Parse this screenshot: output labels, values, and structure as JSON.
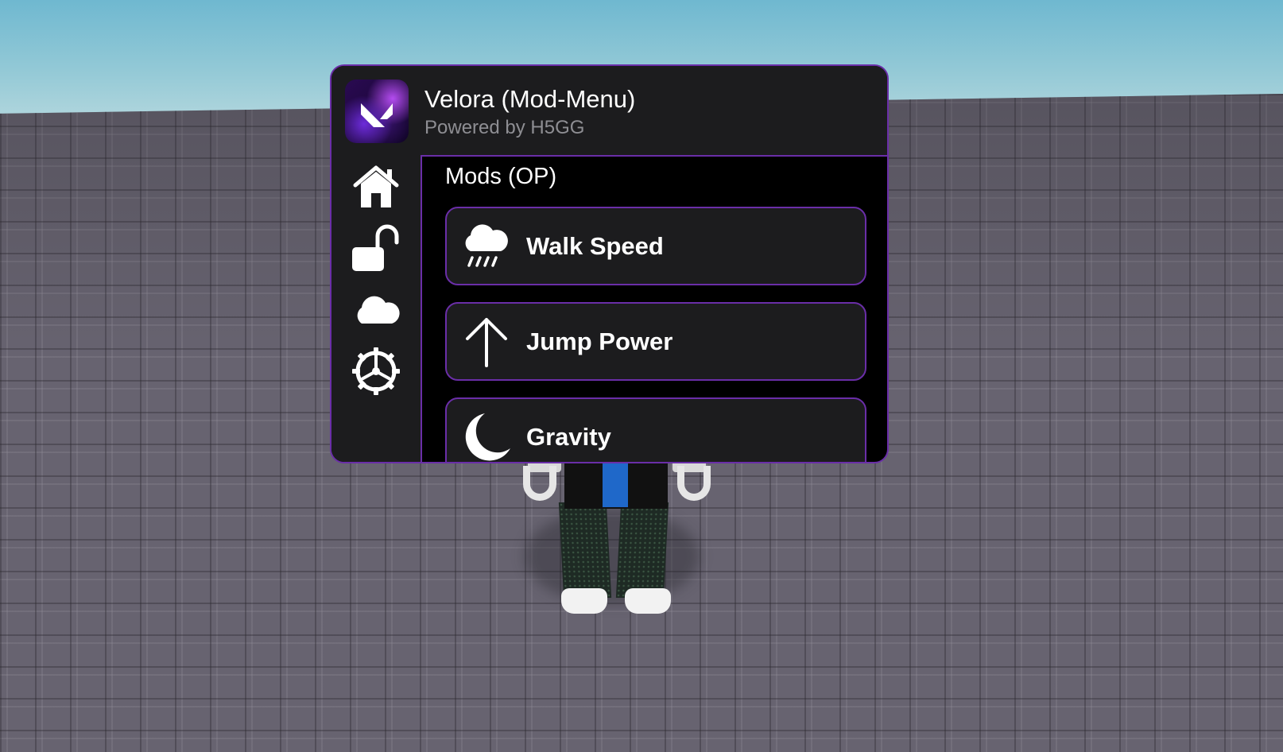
{
  "app": {
    "title": "Velora (Mod-Menu)",
    "subtitle": "Powered by H5GG",
    "accent_color": "#6a2ea8",
    "logo_icon": "velora-v-logo"
  },
  "sidebar": {
    "items": [
      {
        "icon": "house-icon"
      },
      {
        "icon": "unlock-icon"
      },
      {
        "icon": "cloud-icon"
      },
      {
        "icon": "gear-icon"
      }
    ]
  },
  "content": {
    "section_title": "Mods (OP)",
    "mods": [
      {
        "label": "Walk Speed",
        "icon": "cloud-rain-icon"
      },
      {
        "label": "Jump Power",
        "icon": "arrow-up-icon"
      },
      {
        "label": "Gravity",
        "icon": "moon-icon"
      }
    ]
  }
}
